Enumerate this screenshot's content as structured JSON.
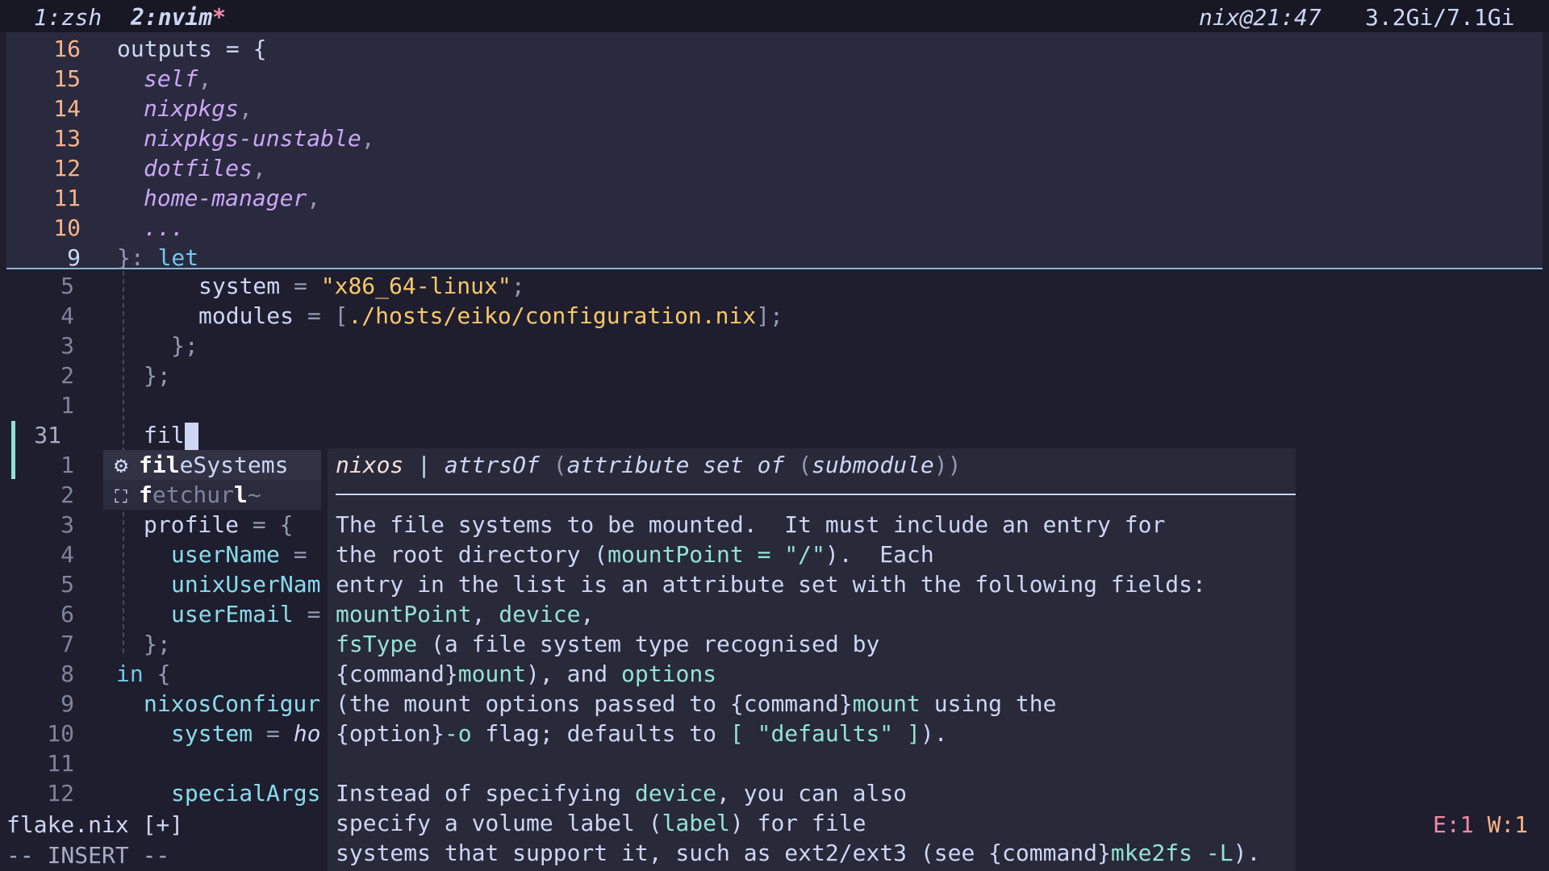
{
  "tabline": {
    "tab1": "1:zsh",
    "tab2": "2:nvim",
    "tab2_modified": "*",
    "host_time": "nix@21:47",
    "memory": "3.2Gi/7.1Gi"
  },
  "context": [
    {
      "lnr": "16",
      "code": "outputs = {"
    },
    {
      "lnr": "15",
      "code": "self"
    },
    {
      "lnr": "14",
      "code": "nixpkgs"
    },
    {
      "lnr": "13",
      "code": "nixpkgs-unstable"
    },
    {
      "lnr": "12",
      "code": "dotfiles"
    },
    {
      "lnr": "11",
      "code": "home-manager"
    },
    {
      "lnr": "10",
      "code": "..."
    },
    {
      "lnr": "9",
      "code": "let"
    }
  ],
  "editor": {
    "lines": [
      {
        "lnr": "5"
      },
      {
        "lnr": "4"
      },
      {
        "lnr": "3"
      },
      {
        "lnr": "2"
      },
      {
        "lnr": "1"
      },
      {
        "lnr": "31"
      },
      {
        "lnr": "1"
      },
      {
        "lnr": "2"
      },
      {
        "lnr": "3"
      },
      {
        "lnr": "4"
      },
      {
        "lnr": "5"
      },
      {
        "lnr": "6"
      },
      {
        "lnr": "7"
      },
      {
        "lnr": "8"
      },
      {
        "lnr": "9"
      },
      {
        "lnr": "10"
      },
      {
        "lnr": "11"
      },
      {
        "lnr": "12"
      }
    ],
    "system_key": "system",
    "system_val": "\"x86_64-linux\"",
    "modules_key": "modules",
    "modules_val": "./hosts/eiko/configuration.nix",
    "typed": "fil",
    "profile": "profile",
    "username": "userName",
    "unixusername": "unixUserNam",
    "useremail": "userEmail",
    "in_kw": "in",
    "nixosconfig": "nixosConfigur",
    "system2": "system",
    "ho": "ho",
    "specialargs": "specialArgs"
  },
  "completion": {
    "items": [
      {
        "icon": "gear-icon",
        "glyph": "⚙",
        "match": "fil",
        "rest": "eSystems",
        "selected": true
      },
      {
        "icon": "snippet-icon",
        "glyph": "⛶",
        "match": "f",
        "mid": "etchur",
        "match2": "l",
        "rest": "~",
        "selected": false
      }
    ]
  },
  "doc": {
    "sig_source": "nixos",
    "sig_sep": " | ",
    "sig_type": "attrsOf",
    "sig_paren": "(",
    "sig_attr": "attribute",
    "sig_mid": " set of ",
    "sig_sub": "submodule",
    "sig_close": "))",
    "l1": "The file systems to be mounted.  It must include an entry for",
    "l2a": "the root directory (",
    "l2b": "mountPoint = \"/\"",
    "l2c": ").  Each",
    "l3": "entry in the list is an attribute set with the following fields:",
    "l4a": "mountPoint",
    "l4b": ", ",
    "l4c": "device",
    "l4d": ",",
    "l5a": "fsType",
    "l5b": " (a file system type recognised by",
    "l6a": "{command}",
    "l6b": "mount",
    "l6c": "), and ",
    "l6d": "options",
    "l7a": "(the mount options passed to {command}",
    "l7b": "mount",
    "l7c": " using the",
    "l8a": "{option}",
    "l8b": "-o",
    "l8c": " flag; defaults to ",
    "l8d": "[ \"defaults\" ]",
    "l8e": ").",
    "l10a": "Instead of specifying ",
    "l10b": "device",
    "l10c": ", you can also",
    "l11a": "specify a volume label (",
    "l11b": "label",
    "l11c": ") for file",
    "l12a": "systems that support it, such as ext2/ext3 (see {command}",
    "l12b": "mke2fs -L",
    "l12c": ")."
  },
  "statusline": {
    "filename": "flake.nix [+]",
    "errors": "E:1",
    "warnings": "W:1"
  },
  "mode": "-- INSERT --"
}
